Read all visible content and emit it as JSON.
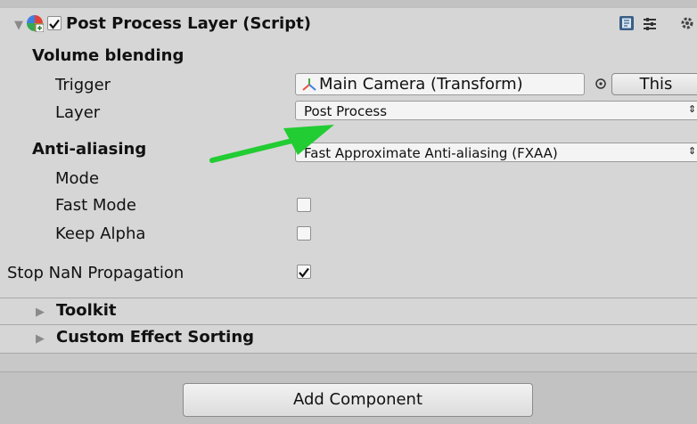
{
  "component": {
    "title": "Post Process Layer (Script)",
    "enabled": true,
    "icons": [
      "foldout-arrow-icon",
      "script-component-icon",
      "help-book-icon",
      "presets-icon",
      "settings-gear-icon"
    ]
  },
  "volume_blending": {
    "heading": "Volume blending",
    "trigger_label": "Trigger",
    "trigger_value": "Main Camera  (Transform)",
    "trigger_button": "This",
    "layer_label": "Layer",
    "layer_value": "Post Process"
  },
  "anti_aliasing": {
    "heading": "Anti-aliasing",
    "mode_label": "Mode",
    "mode_value": "Fast Approximate Anti-aliasing (FXAA)",
    "fast_mode_label": "Fast Mode",
    "fast_mode_checked": false,
    "keep_alpha_label": "Keep Alpha",
    "keep_alpha_checked": false
  },
  "stop_nan": {
    "label": "Stop NaN Propagation",
    "checked": true
  },
  "foldouts": {
    "toolkit": "Toolkit",
    "custom_sorting": "Custom Effect Sorting"
  },
  "add_component_label": "Add Component",
  "annotation": {
    "color": "#22cc33"
  }
}
